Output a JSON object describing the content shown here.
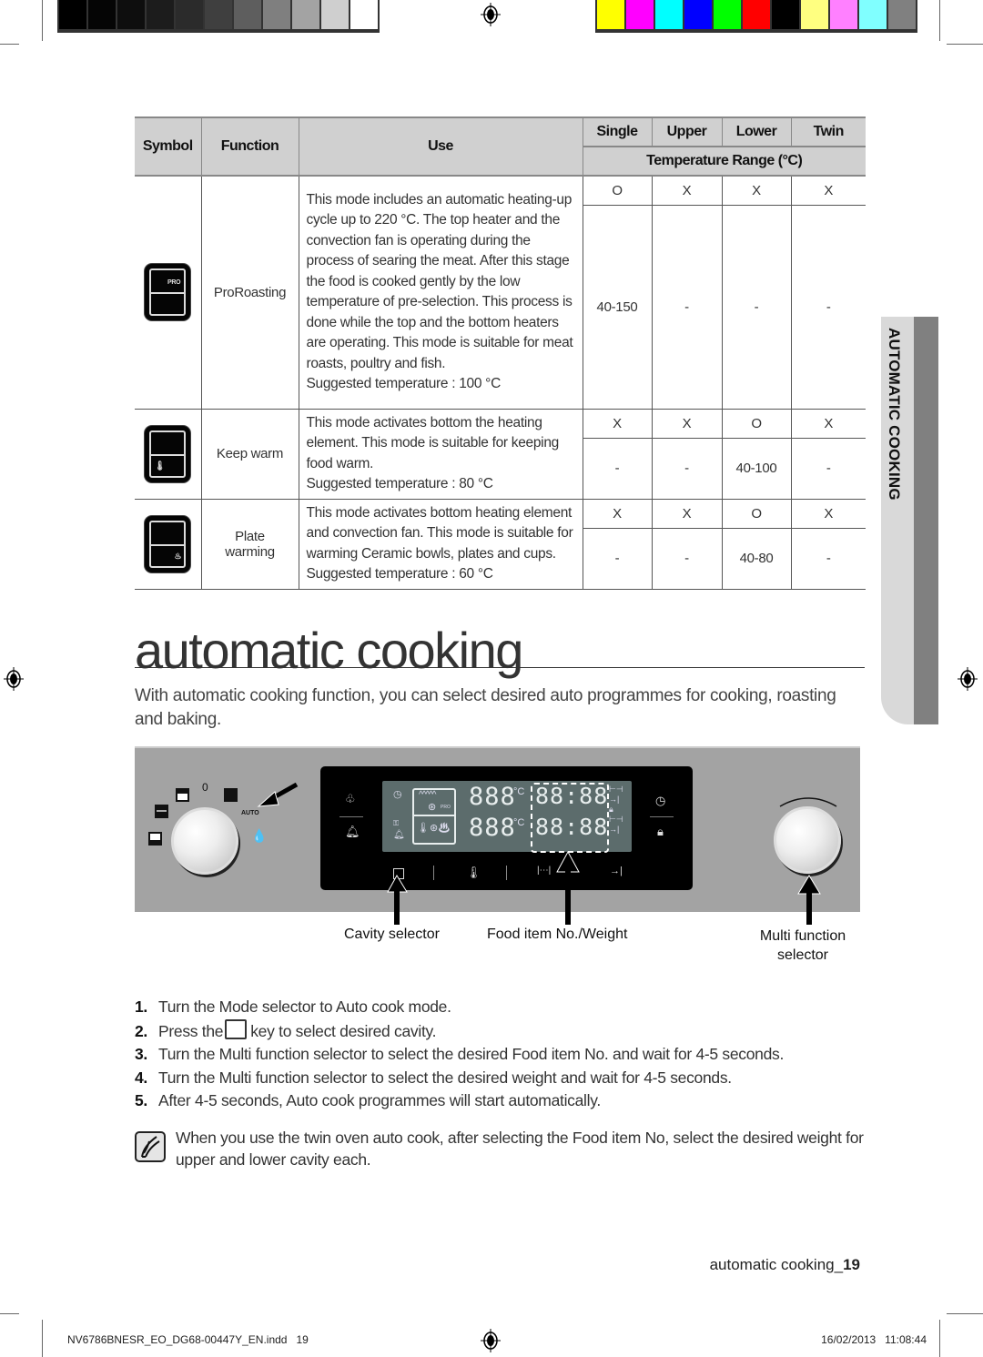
{
  "print_marks": {
    "grayscale_swatches": [
      "#000000",
      "#050505",
      "#0e0e0e",
      "#1c1c1c",
      "#2b2b2b",
      "#3f3f3f",
      "#5e5e5e",
      "#7f7f7f",
      "#a3a3a3",
      "#cfcfcf",
      "#ffffff"
    ],
    "color_swatches": [
      "#ffff00",
      "#ff00ff",
      "#00ffff",
      "#0000ff",
      "#00ff00",
      "#ff0000",
      "#000000",
      "#ffff80",
      "#ff80ff",
      "#80ffff",
      "#808080"
    ]
  },
  "table": {
    "headers": {
      "symbol": "Symbol",
      "function": "Function",
      "use": "Use",
      "single": "Single",
      "upper": "Upper",
      "lower": "Lower",
      "twin": "Twin",
      "temp_range": "Temperature Range (°C)"
    },
    "rows": [
      {
        "icon": "pro-roasting-icon",
        "icon_label": "PRO",
        "function": "ProRoasting",
        "use": "This mode includes an automatic heating-up cycle up to 220 °C. The top heater and the convection fan is operating during the process of searing the meat. After this stage the food is cooked gently by the low temperature of pre-selection. This process is done while the top and the bottom heaters are operating. This mode is suitable for meat roasts, poultry and fish.",
        "suggested": "Suggested temperature : 100 °C",
        "availability": [
          "O",
          "X",
          "X",
          "X"
        ],
        "ranges": [
          "40-150",
          "-",
          "-",
          "-"
        ]
      },
      {
        "icon": "keep-warm-icon",
        "function": "Keep warm",
        "use": "This mode activates bottom the heating element. This mode is suitable for keeping food warm.",
        "suggested": "Suggested temperature : 80 °C",
        "availability": [
          "X",
          "X",
          "O",
          "X"
        ],
        "ranges": [
          "-",
          "-",
          "40-100",
          "-"
        ]
      },
      {
        "icon": "plate-warming-icon",
        "function_line1": "Plate",
        "function_line2": "warming",
        "use": "This mode activates bottom heating element and convection fan. This mode is suitable for warming Ceramic bowls, plates and cups.",
        "suggested": "Suggested temperature : 60 °C",
        "availability": [
          "X",
          "X",
          "O",
          "X"
        ],
        "ranges": [
          "-",
          "-",
          "40-80",
          "-"
        ]
      }
    ]
  },
  "side_tab": "AUTOMATIC COOKING",
  "section": {
    "title": "automatic cooking",
    "intro": "With automatic cooking function, you can select desired auto programmes for cooking, roasting and baking."
  },
  "panel": {
    "mode_dial_zero": "0",
    "mode_dial_auto": "AUTO",
    "lcd_temp_digits": "888",
    "lcd_unit": "°C",
    "lcd_time_digits": "88:88",
    "lcd_pro": "PRO",
    "labels": {
      "cavity": "Cavity selector",
      "food": "Food item No./Weight",
      "multi_line1": "Multi function",
      "multi_line2": "selector"
    }
  },
  "steps": [
    {
      "num": "1.",
      "text": "Turn the Mode selector to Auto cook mode."
    },
    {
      "num": "2.",
      "pre": "Press the",
      "post": "key to select desired cavity."
    },
    {
      "num": "3.",
      "text": "Turn the Multi function selector to select the desired Food item No. and wait for 4-5 seconds."
    },
    {
      "num": "4.",
      "text": "Turn the Multi function selector to select the desired weight and wait for 4-5 seconds."
    },
    {
      "num": "5.",
      "text": "After 4-5 seconds, Auto cook programmes will start automatically."
    }
  ],
  "note": "When you use the twin oven auto cook, after selecting the Food item No, select the desired weight for upper and lower cavity each.",
  "footer": {
    "page_label": "automatic cooking_",
    "page_number": "19",
    "slug_file": "NV6786BNESR_EO_DG68-00447Y_EN.indd   19",
    "slug_date": "16/02/2013   11:08:44"
  }
}
